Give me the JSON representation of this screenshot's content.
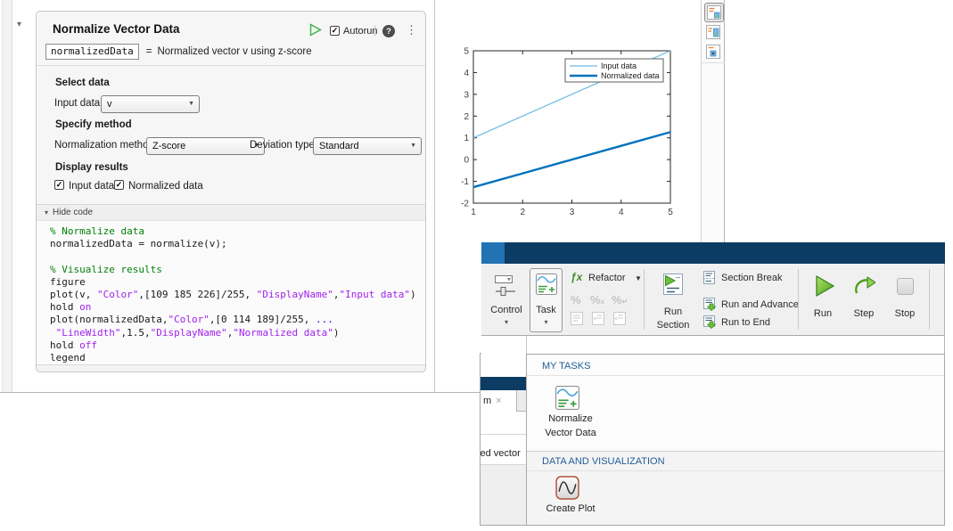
{
  "icons": {
    "collapse": "▾",
    "select_arrow": "▼",
    "menu_arrow": "▼",
    "small_down": "▾",
    "ellipsis": "⋮",
    "help": "?",
    "check": "✓",
    "pipe": "|",
    "close": "×",
    "fx": "ƒx",
    "percent": "%",
    "percent_x": "x",
    "percent_enter": "↵"
  },
  "colors": {
    "titlebar": "#0c3c64",
    "titlebar_accent": "#2173b4",
    "input_series": "#6db9e2",
    "normalized_series": "#0072bd",
    "comment_green": "#028009",
    "string_purple": "#a020f0",
    "gallery_header_blue": "#1f5c99"
  },
  "back_window": {
    "task": {
      "title": "Normalize Vector Data",
      "autorun_label": "Autorun",
      "variable_name": "normalizedData",
      "equals": "=",
      "summary": "Normalized vector v using z-score",
      "select_data_header": "Select data",
      "input_data_label": "Input data",
      "input_data_value": "v",
      "specify_method_header": "Specify method",
      "normalization_method_label": "Normalization method",
      "normalization_method_value": "Z-score",
      "deviation_type_label": "Deviation type",
      "deviation_type_value": "Standard",
      "display_results_header": "Display results",
      "display_input_label": "Input data",
      "display_normalized_label": "Normalized data",
      "hide_code_label": "Hide code"
    },
    "code": {
      "lines": [
        [
          {
            "t": "% Normalize data",
            "c": "com"
          }
        ],
        [
          {
            "t": "normalizedData = normalize(v);",
            "c": "txt"
          }
        ],
        [],
        [
          {
            "t": "% Visualize results",
            "c": "com"
          }
        ],
        [
          {
            "t": "figure",
            "c": "txt"
          }
        ],
        [
          {
            "t": "plot(v, ",
            "c": "txt"
          },
          {
            "t": "\"Color\"",
            "c": "str"
          },
          {
            "t": ",[109 185 226]/255, ",
            "c": "txt"
          },
          {
            "t": "\"DisplayName\"",
            "c": "str"
          },
          {
            "t": ",",
            "c": "txt"
          },
          {
            "t": "\"Input data\"",
            "c": "str"
          },
          {
            "t": ")",
            "c": "txt"
          }
        ],
        [
          {
            "t": "hold ",
            "c": "txt"
          },
          {
            "t": "on",
            "c": "str"
          }
        ],
        [
          {
            "t": "plot(normalizedData,",
            "c": "txt"
          },
          {
            "t": "\"Color\"",
            "c": "str"
          },
          {
            "t": ",[0 114 189]/255, ",
            "c": "txt"
          },
          {
            "t": "...",
            "c": "cont"
          }
        ],
        [
          {
            "t": " ",
            "c": "txt"
          },
          {
            "t": "\"LineWidth\"",
            "c": "str"
          },
          {
            "t": ",1.5,",
            "c": "txt"
          },
          {
            "t": "\"DisplayName\"",
            "c": "str"
          },
          {
            "t": ",",
            "c": "txt"
          },
          {
            "t": "\"Normalized data\"",
            "c": "str"
          },
          {
            "t": ")",
            "c": "txt"
          }
        ],
        [
          {
            "t": "hold ",
            "c": "txt"
          },
          {
            "t": "off",
            "c": "str"
          }
        ],
        [
          {
            "t": "legend",
            "c": "txt"
          }
        ]
      ]
    }
  },
  "chart_data": {
    "type": "line",
    "title": "",
    "xlabel": "",
    "ylabel": "",
    "x": [
      1,
      2,
      3,
      4,
      5
    ],
    "series": [
      {
        "name": "Input data",
        "values": [
          1,
          2,
          3,
          4,
          5
        ],
        "color": "#6db9e2",
        "line_width": 1.2
      },
      {
        "name": "Normalized data",
        "values": [
          -1.2649,
          -0.6325,
          0,
          0.6325,
          1.2649
        ],
        "color": "#0072bd",
        "line_width": 2.4
      }
    ],
    "xlim": [
      1,
      5
    ],
    "ylim": [
      -2,
      5
    ],
    "xticks": [
      1,
      2,
      3,
      4,
      5
    ],
    "yticks": [
      -2,
      -1,
      0,
      1,
      2,
      3,
      4,
      5
    ],
    "grid": false,
    "legend_position": "northeast"
  },
  "middle_window": {
    "tab_label": "m",
    "partial_text": "zed vector"
  },
  "front_window": {
    "toolbar": {
      "control": "Control",
      "task": "Task",
      "refactor": "Refactor",
      "run_section_line1": "Run",
      "run_section_line2": "Section",
      "section_break": "Section Break",
      "run_and_advance": "Run and Advance",
      "run_to_end": "Run to End",
      "run": "Run",
      "step": "Step",
      "stop": "Stop"
    },
    "gallery": {
      "sections": [
        {
          "title": "MY TASKS",
          "item_label_line1": "Normalize",
          "item_label_line2": "Vector Data"
        },
        {
          "title": "DATA AND VISUALIZATION",
          "item_label": "Create Plot"
        }
      ]
    }
  }
}
